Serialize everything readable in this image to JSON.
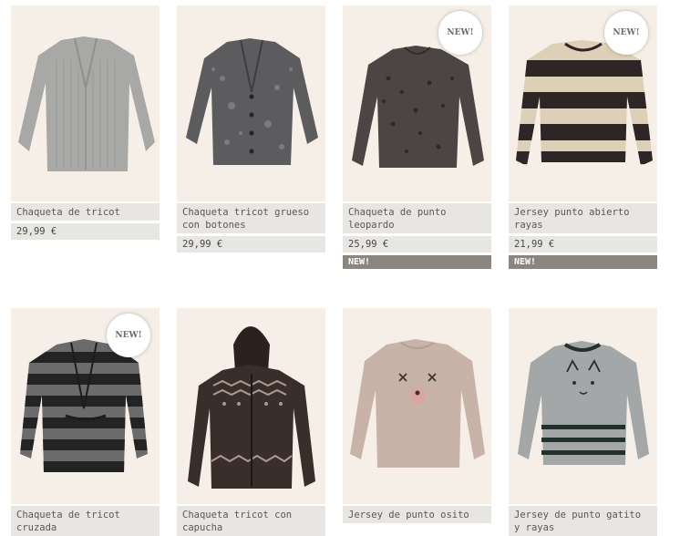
{
  "products": [
    {
      "name": "Chaqueta de tricot",
      "price": "29,99 €",
      "badge": "",
      "bar": ""
    },
    {
      "name": "Chaqueta tricot grueso con botones",
      "price": "29,99 €",
      "badge": "",
      "bar": ""
    },
    {
      "name": "Chaqueta de punto leopardo",
      "price": "25,99 €",
      "badge": "NEW!",
      "bar": "NEW!"
    },
    {
      "name": "Jersey punto abierto rayas",
      "price": "21,99 €",
      "badge": "NEW!",
      "bar": "NEW!"
    },
    {
      "name": "Chaqueta de tricot cruzada",
      "price": "",
      "badge": "NEW!",
      "bar": ""
    },
    {
      "name": "Chaqueta tricot con capucha",
      "price": "",
      "badge": "",
      "bar": ""
    },
    {
      "name": "Jersey de punto osito",
      "price": "",
      "badge": "",
      "bar": ""
    },
    {
      "name": "Jersey de punto gatito y rayas",
      "price": "",
      "badge": "",
      "bar": ""
    }
  ],
  "icons": [
    "grey-cardigan-photo",
    "marled-cardigan-photo",
    "leopard-cardigan-photo",
    "striped-sweater-photo",
    "striped-wrap-cardigan-photo",
    "hooded-fairisle-cardigan-photo",
    "bear-sweater-photo",
    "cat-striped-sweater-photo"
  ],
  "colors": {
    "photo_bg": "#f6efe8",
    "label_bg": "#e8e6e2",
    "new_bar_bg": "#8b8580",
    "text": "#5a5754"
  }
}
